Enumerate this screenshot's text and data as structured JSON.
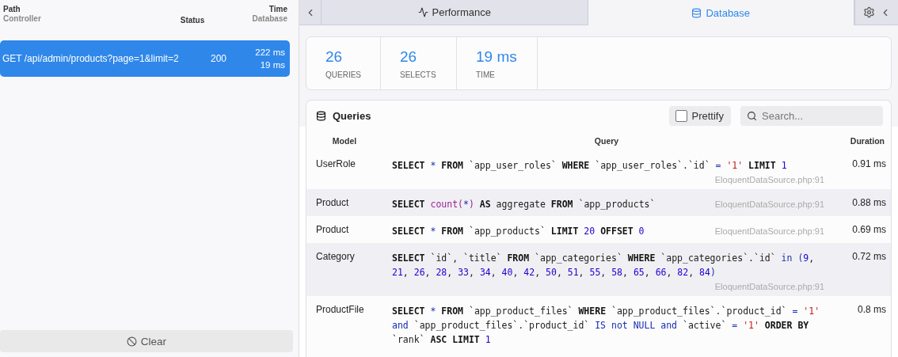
{
  "requests": {
    "columns": [
      {
        "top": "Path",
        "bottom": "Controller"
      },
      {
        "top": "Status"
      },
      {
        "top": "Time",
        "bottom": "Database"
      }
    ],
    "rows": [
      {
        "path": "GET /api/admin/products?page=1&limit=2",
        "status": "200",
        "time": "222 ms",
        "database": "19 ms",
        "selected": true
      }
    ],
    "clear_button": "Clear"
  },
  "tabs": [
    {
      "label": "Performance",
      "kind": "activity",
      "selected": false
    },
    {
      "label": "Database",
      "kind": "database",
      "selected": true
    }
  ],
  "stats": [
    {
      "value": "26",
      "label": "QUERIES"
    },
    {
      "value": "26",
      "label": "SELECTS"
    },
    {
      "value": "19 ms",
      "label": "TIME"
    }
  ],
  "queries": {
    "title": "Queries",
    "prettify": {
      "label": "Prettify",
      "checked": false
    },
    "search": {
      "placeholder": "Search..."
    },
    "columns": [
      "Model",
      "Query",
      "Duration"
    ],
    "rows": [
      {
        "model": "UserRole",
        "duration": "0.91 ms",
        "source": "EloquentDataSource.php:91",
        "tokens": [
          {
            "kind": "kw",
            "t": "SELECT "
          },
          {
            "kind": "op",
            "t": "* "
          },
          {
            "kind": "kw",
            "t": "FROM "
          },
          {
            "kind": "id",
            "t": "`app_user_roles` "
          },
          {
            "kind": "kw",
            "t": "WHERE "
          },
          {
            "kind": "id",
            "t": "`app_user_roles`.`id` "
          },
          {
            "kind": "op",
            "t": "= "
          },
          {
            "kind": "str",
            "t": "'1' "
          },
          {
            "kind": "kw",
            "t": "LIMIT "
          },
          {
            "kind": "num",
            "t": "1"
          }
        ]
      },
      {
        "model": "Product",
        "duration": "0.88 ms",
        "source": "EloquentDataSource.php:91",
        "tokens": [
          {
            "kind": "kw",
            "t": "SELECT "
          },
          {
            "kind": "fn",
            "t": "count("
          },
          {
            "kind": "op",
            "t": "*"
          },
          {
            "kind": "fn",
            "t": ") "
          },
          {
            "kind": "kw",
            "t": "AS "
          },
          {
            "kind": "id",
            "t": "aggregate "
          },
          {
            "kind": "kw",
            "t": "FROM "
          },
          {
            "kind": "id",
            "t": "`app_products`"
          }
        ]
      },
      {
        "model": "Product",
        "duration": "0.69 ms",
        "source": "EloquentDataSource.php:91",
        "tokens": [
          {
            "kind": "kw",
            "t": "SELECT "
          },
          {
            "kind": "op",
            "t": "* "
          },
          {
            "kind": "kw",
            "t": "FROM "
          },
          {
            "kind": "id",
            "t": "`app_products` "
          },
          {
            "kind": "kw",
            "t": "LIMIT "
          },
          {
            "kind": "num",
            "t": "20 "
          },
          {
            "kind": "kw",
            "t": "OFFSET "
          },
          {
            "kind": "num",
            "t": "0"
          }
        ]
      },
      {
        "model": "Category",
        "duration": "0.72 ms",
        "source": "EloquentDataSource.php:91",
        "tokens": [
          {
            "kind": "kw",
            "t": "SELECT "
          },
          {
            "kind": "id",
            "t": "`id`, `title` "
          },
          {
            "kind": "kw",
            "t": "FROM "
          },
          {
            "kind": "id",
            "t": "`app_categories` "
          },
          {
            "kind": "kw",
            "t": "WHERE "
          },
          {
            "kind": "id",
            "t": "`app_categories`.`id` "
          },
          {
            "kind": "op",
            "t": "in ("
          },
          {
            "kind": "num",
            "t": "9"
          },
          {
            "kind": "id",
            "t": ", "
          },
          {
            "kind": "num",
            "t": "21"
          },
          {
            "kind": "id",
            "t": ", "
          },
          {
            "kind": "num",
            "t": "26"
          },
          {
            "kind": "id",
            "t": ", "
          },
          {
            "kind": "num",
            "t": "28"
          },
          {
            "kind": "id",
            "t": ", "
          },
          {
            "kind": "num",
            "t": "33"
          },
          {
            "kind": "id",
            "t": ", "
          },
          {
            "kind": "num",
            "t": "34"
          },
          {
            "kind": "id",
            "t": ", "
          },
          {
            "kind": "num",
            "t": "40"
          },
          {
            "kind": "id",
            "t": ", "
          },
          {
            "kind": "num",
            "t": "42"
          },
          {
            "kind": "id",
            "t": ", "
          },
          {
            "kind": "num",
            "t": "50"
          },
          {
            "kind": "id",
            "t": ", "
          },
          {
            "kind": "num",
            "t": "51"
          },
          {
            "kind": "id",
            "t": ", "
          },
          {
            "kind": "num",
            "t": "55"
          },
          {
            "kind": "id",
            "t": ", "
          },
          {
            "kind": "num",
            "t": "58"
          },
          {
            "kind": "id",
            "t": ", "
          },
          {
            "kind": "num",
            "t": "65"
          },
          {
            "kind": "id",
            "t": ", "
          },
          {
            "kind": "num",
            "t": "66"
          },
          {
            "kind": "id",
            "t": ", "
          },
          {
            "kind": "num",
            "t": "82"
          },
          {
            "kind": "id",
            "t": ", "
          },
          {
            "kind": "num",
            "t": "84"
          },
          {
            "kind": "op",
            "t": ")"
          }
        ]
      },
      {
        "model": "ProductFile",
        "duration": "0.8 ms",
        "tokens": [
          {
            "kind": "kw",
            "t": "SELECT "
          },
          {
            "kind": "op",
            "t": "* "
          },
          {
            "kind": "kw",
            "t": "FROM "
          },
          {
            "kind": "id",
            "t": "`app_product_files` "
          },
          {
            "kind": "kw",
            "t": "WHERE "
          },
          {
            "kind": "id",
            "t": "`app_product_files`.`product_id` "
          },
          {
            "kind": "op",
            "t": "= "
          },
          {
            "kind": "str",
            "t": "'1' "
          },
          {
            "kind": "op",
            "t": "and "
          },
          {
            "kind": "id",
            "t": "`app_product_files`.`product_id` "
          },
          {
            "kind": "op",
            "t": "IS not NULL and "
          },
          {
            "kind": "id",
            "t": "`active` "
          },
          {
            "kind": "op",
            "t": "= "
          },
          {
            "kind": "str",
            "t": "'1' "
          },
          {
            "kind": "kw",
            "t": "ORDER BY "
          },
          {
            "kind": "id",
            "t": "`rank` "
          },
          {
            "kind": "kw",
            "t": "ASC LIMIT "
          },
          {
            "kind": "num",
            "t": "1"
          }
        ]
      }
    ]
  }
}
